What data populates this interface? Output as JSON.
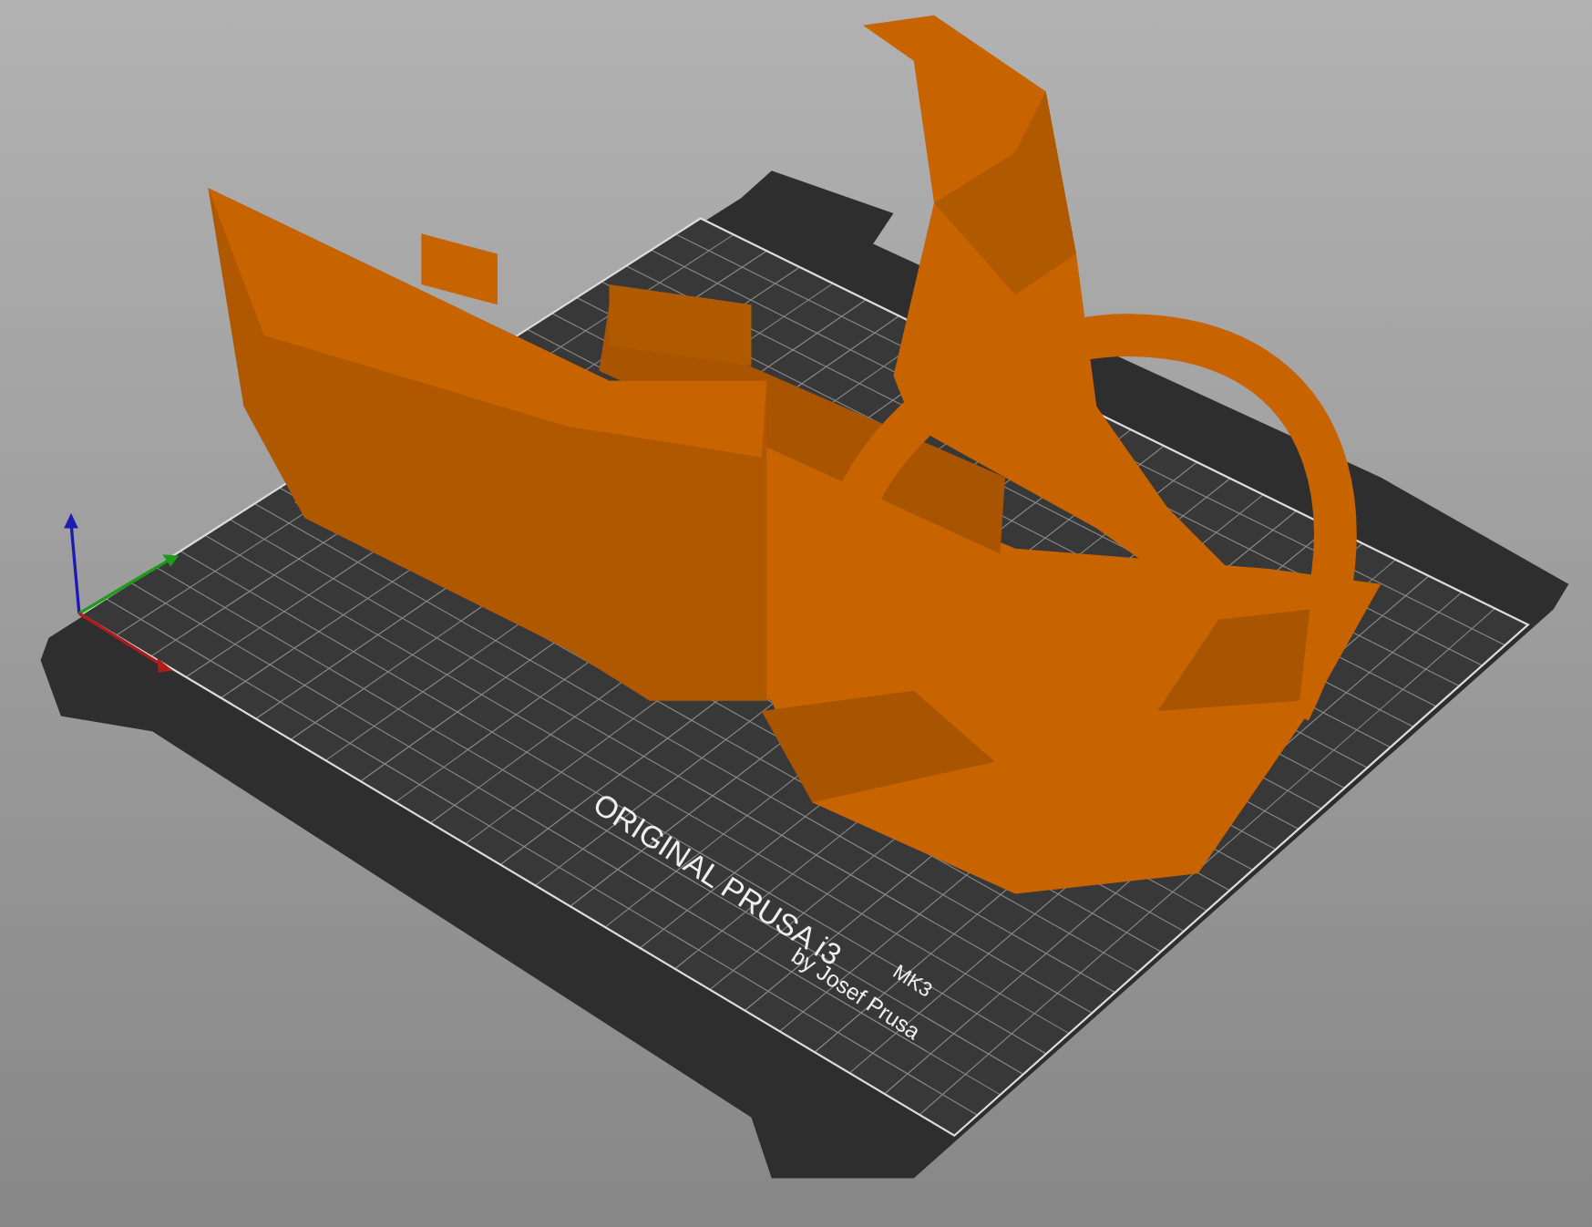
{
  "viewport": {
    "bed_label": {
      "title": "ORIGINAL PRUSA i3",
      "model": "MK3",
      "subtitle": "by Josef Prusa"
    }
  }
}
